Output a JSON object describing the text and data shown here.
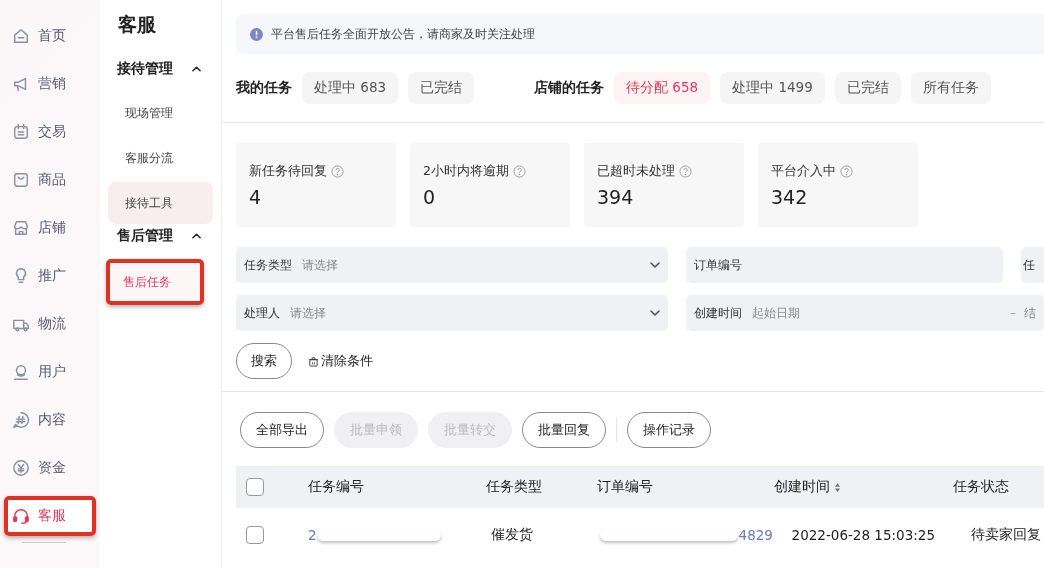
{
  "nav": {
    "items": [
      {
        "label": "首页",
        "selected": false
      },
      {
        "label": "营销",
        "selected": false
      },
      {
        "label": "交易",
        "selected": false
      },
      {
        "label": "商品",
        "selected": false
      },
      {
        "label": "店铺",
        "selected": false
      },
      {
        "label": "推广",
        "selected": false
      },
      {
        "label": "物流",
        "selected": false
      },
      {
        "label": "用户",
        "selected": false
      },
      {
        "label": "内容",
        "selected": false
      },
      {
        "label": "资金",
        "selected": false
      },
      {
        "label": "客服",
        "selected": true,
        "highlighted": true
      }
    ]
  },
  "subnav": {
    "title": "客服",
    "groups": [
      {
        "label": "接待管理",
        "expanded": true,
        "children": [
          {
            "label": "现场管理",
            "selected": false,
            "hovered": false
          },
          {
            "label": "客服分流",
            "selected": false,
            "hovered": false
          },
          {
            "label": "接待工具",
            "selected": false,
            "hovered": true
          }
        ]
      },
      {
        "label": "售后管理",
        "expanded": true,
        "children": [
          {
            "label": "售后任务",
            "selected": true,
            "highlighted": true
          }
        ]
      }
    ]
  },
  "notice": "平台售后任务全面开放公告，请商家及时关注处理",
  "task_groups": [
    {
      "label": "我的任务",
      "tabs": [
        {
          "label": "处理中 683",
          "selected": false
        },
        {
          "label": "已完结",
          "selected": false
        }
      ]
    },
    {
      "label": "店铺的任务",
      "tabs": [
        {
          "label": "待分配 658",
          "selected": true
        },
        {
          "label": "处理中 1499",
          "selected": false
        },
        {
          "label": "已完结",
          "selected": false
        },
        {
          "label": "所有任务",
          "selected": false
        }
      ]
    }
  ],
  "stats": [
    {
      "label": "新任务待回复",
      "value": "4"
    },
    {
      "label": "2小时内将逾期",
      "value": "0"
    },
    {
      "label": "已超时未处理",
      "value": "394"
    },
    {
      "label": "平台介入中",
      "value": "342"
    }
  ],
  "filters": [
    [
      {
        "kind": "select",
        "label": "任务类型",
        "placeholder": "请选择"
      },
      {
        "kind": "text",
        "label": "订单编号"
      },
      {
        "kind": "text",
        "label": "任"
      }
    ],
    [
      {
        "kind": "select",
        "label": "处理人",
        "placeholder": "请选择"
      },
      {
        "kind": "range",
        "label": "创建时间",
        "placeholder": "起始日期",
        "separator": "–",
        "end": "结"
      }
    ]
  ],
  "search_button": "搜索",
  "clear_button": "清除条件",
  "actions": [
    {
      "label": "全部导出",
      "disabled": false
    },
    {
      "label": "批量申领",
      "disabled": true
    },
    {
      "label": "批量转交",
      "disabled": true
    },
    {
      "label": "批量回复",
      "disabled": false
    },
    {
      "label": "操作记录",
      "disabled": false,
      "separated": true
    }
  ],
  "table": {
    "all_checked": false,
    "columns": [
      {
        "label": "任务编号",
        "sortable": false
      },
      {
        "label": "任务类型",
        "sortable": false
      },
      {
        "label": "订单编号",
        "sortable": false
      },
      {
        "label": "创建时间",
        "sortable": true
      },
      {
        "label": "任务状态",
        "sortable": false
      }
    ],
    "rows": [
      {
        "checked": false,
        "cells": [
          "2",
          "催发货",
          "4829",
          "2022-06-28 15:03:25",
          "待卖家回复"
        ]
      }
    ]
  }
}
